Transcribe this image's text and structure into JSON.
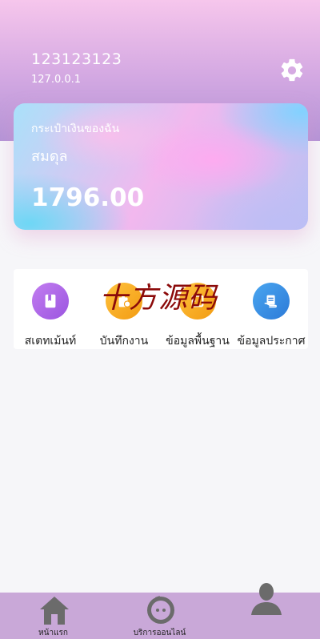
{
  "header": {
    "username": "123123123",
    "ip": "127.0.0.1"
  },
  "wallet": {
    "title": "กระเป๋าเงินของฉัน",
    "balance_label": "สมดุล",
    "balance": "1796.00"
  },
  "menu": [
    {
      "label": "สเตทเม้นท์",
      "icon": "statement-icon",
      "color": "#b26be8"
    },
    {
      "label": "บันทึกงาน",
      "icon": "task-record-icon",
      "color": "#f5a623"
    },
    {
      "label": "ข้อมูลพื้นฐาน",
      "icon": "basic-info-icon",
      "color": "#f5a623"
    },
    {
      "label": "ข้อมูลประกาศ",
      "icon": "announcement-icon",
      "color": "#3e8ee6"
    }
  ],
  "watermark": "十方源码",
  "bottom_nav": [
    {
      "label": "หน้าแรก",
      "icon": "home-icon"
    },
    {
      "label": "บริการออนไลน์",
      "icon": "chat-icon"
    },
    {
      "label": "",
      "icon": "user-icon"
    }
  ]
}
